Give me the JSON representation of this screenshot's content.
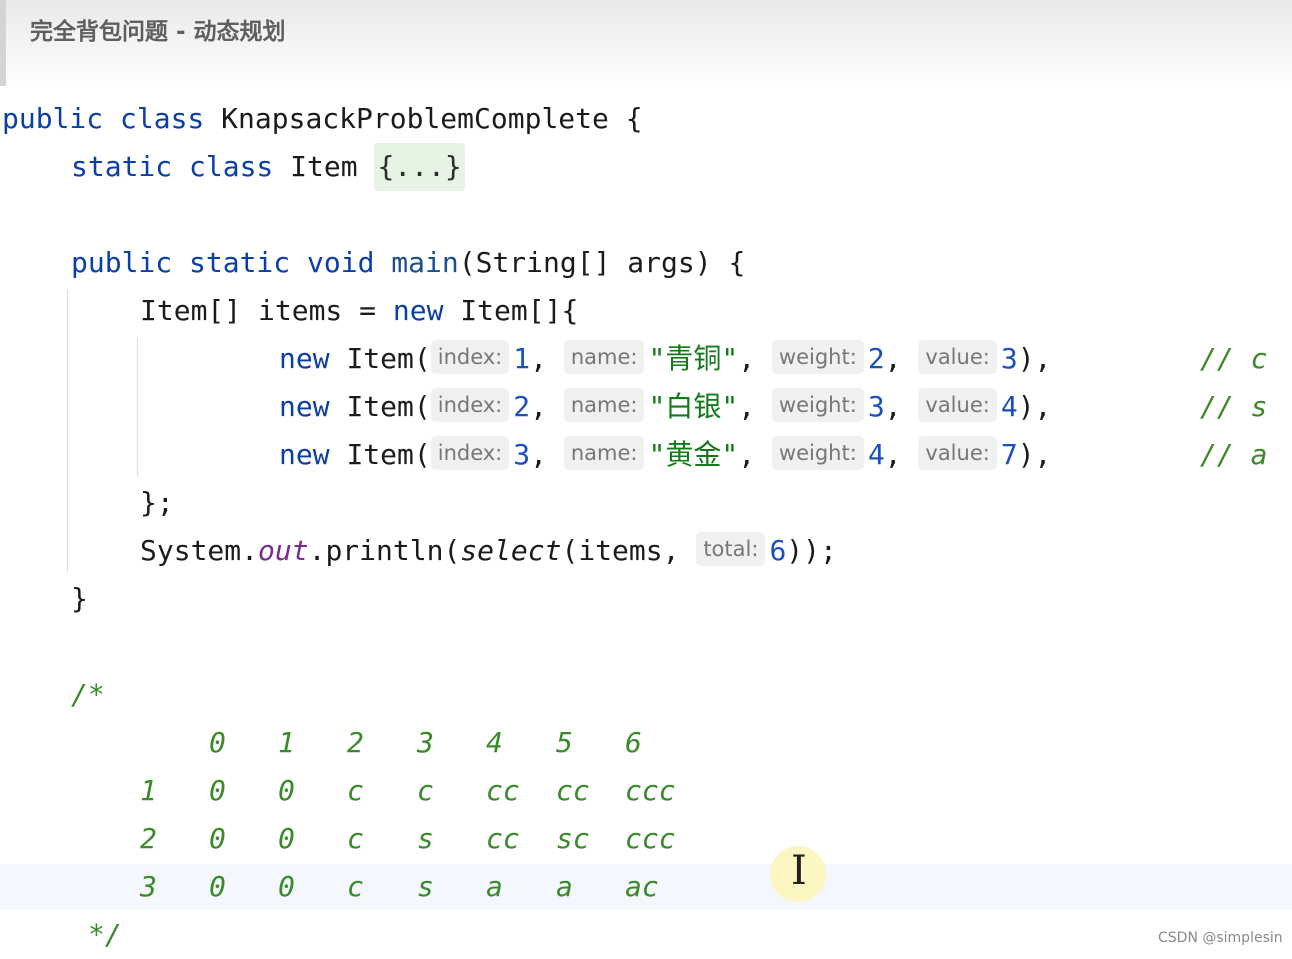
{
  "header": {
    "title": "完全背包问题 - 动态规划"
  },
  "watermark": "CSDN @simplesin",
  "code": {
    "class_kw": "public class",
    "class_name": "KnapsackProblemComplete",
    "open_brace": "{",
    "inner_kw": "static class",
    "inner_name": "Item",
    "inner_fold": "{...}",
    "main_kw": "public static void",
    "main_name": "main",
    "main_args": "(String[] args) {",
    "items_decl_a": "Item[] items = ",
    "items_decl_new": "new",
    "items_decl_b": " Item[]{",
    "rows": [
      {
        "new": "new",
        "ctor": "Item(",
        "h_index": "index:",
        "index": "1",
        "h_name": "name:",
        "name": "\"青铜\"",
        "h_weight": "weight:",
        "weight": "2",
        "h_value": "value:",
        "value": "3",
        "comment": "// c"
      },
      {
        "new": "new",
        "ctor": "Item(",
        "h_index": "index:",
        "index": "2",
        "h_name": "name:",
        "name": "\"白银\"",
        "h_weight": "weight:",
        "weight": "3",
        "h_value": "value:",
        "value": "4",
        "comment": "// s"
      },
      {
        "new": "new",
        "ctor": "Item(",
        "h_index": "index:",
        "index": "3",
        "h_name": "name:",
        "name": "\"黄金\"",
        "h_weight": "weight:",
        "weight": "4",
        "h_value": "value:",
        "value": "7",
        "comment": "// a"
      }
    ],
    "array_close": "};",
    "print_a": "System.",
    "print_out": "out",
    "print_b": ".println(",
    "print_select": "select",
    "print_c": "(items, ",
    "h_total": "total:",
    "total": "6",
    "print_d": "));",
    "main_close": "}",
    "comment_open": "/*",
    "comment_close": "*/"
  },
  "dp_table": {
    "header": [
      "0",
      "1",
      "2",
      "3",
      "4",
      "5",
      "6"
    ],
    "rows": [
      {
        "label": "1",
        "cells": [
          "0",
          "0",
          "c",
          "c",
          "cc",
          "cc",
          "ccc"
        ]
      },
      {
        "label": "2",
        "cells": [
          "0",
          "0",
          "c",
          "s",
          "cc",
          "sc",
          "ccc"
        ]
      },
      {
        "label": "3",
        "cells": [
          "0",
          "0",
          "c",
          "s",
          "a",
          "a",
          "ac"
        ]
      }
    ]
  }
}
